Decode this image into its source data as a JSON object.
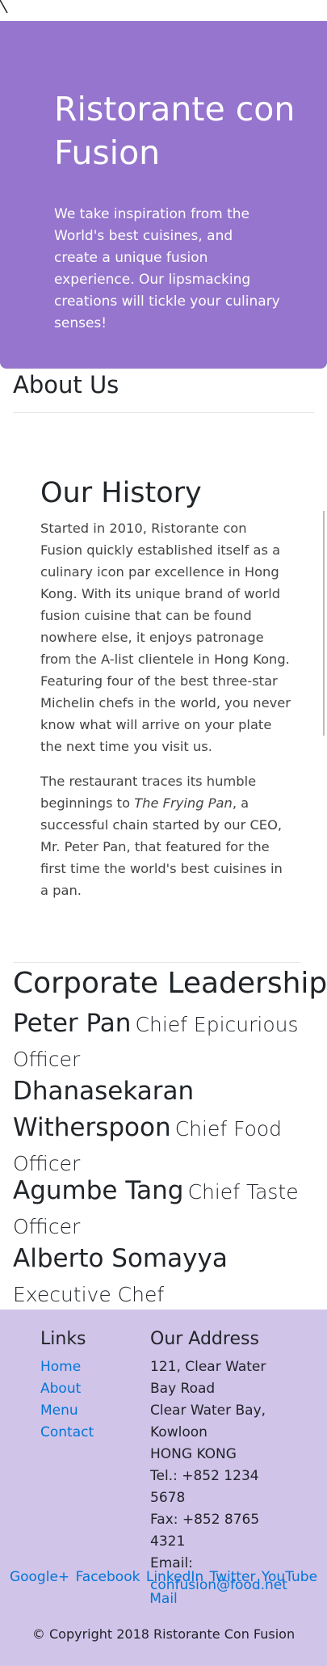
{
  "jumbotron": {
    "title": "Ristorante con Fusion",
    "tagline": "We take inspiration from the World's best cuisines, and create a unique fusion experience. Our lipsmacking creations will tickle your culinary senses!"
  },
  "about": {
    "heading": "About Us"
  },
  "history": {
    "heading": "Our History",
    "paragraph1": "Started in 2010, Ristorante con Fusion quickly established itself as a culinary icon par excellence in Hong Kong. With its unique brand of world fusion cuisine that can be found nowhere else, it enjoys patronage from the A-list clientele in Hong Kong. Featuring four of the best three-star Michelin chefs in the world, you never know what will arrive on your plate the next time you visit us.",
    "paragraph2_before": "The restaurant traces its humble beginnings to ",
    "paragraph2_em": "The Frying Pan",
    "paragraph2_after": ", a successful chain started by our CEO, Mr. Peter Pan, that featured for the first time the world's best cuisines in a pan."
  },
  "leadership": {
    "heading": "Corporate Leadership",
    "leaders": [
      {
        "name": "Peter Pan",
        "title": "Chief Epicurious Officer"
      },
      {
        "name": "Dhanasekaran Witherspoon",
        "title": "Chief Food Officer"
      },
      {
        "name": "Agumbe Tang",
        "title": "Chief Taste Officer"
      },
      {
        "name": "Alberto Somayya",
        "title": "Executive Chef"
      }
    ]
  },
  "footer": {
    "links_heading": "Links",
    "links": [
      "Home",
      "About",
      "Menu",
      "Contact"
    ],
    "address_heading": "Our Address",
    "address_line1": "121, Clear Water Bay Road",
    "address_line2": "Clear Water Bay, Kowloon",
    "address_line3": "HONG KONG",
    "tel": "Tel.: +852 1234 5678",
    "fax": "Fax: +852 8765 4321",
    "email_label": "Email:",
    "email": "confusion@food.net",
    "social": [
      "Google+",
      "Facebook",
      "LinkedIn",
      "Twitter",
      "YouTube",
      "Mail"
    ],
    "copyright": "© Copyright 2018 Ristorante Con Fusion"
  },
  "icons": {
    "nav_toggle": "navbar-toggler-icon"
  },
  "colors": {
    "jumbotron": "#9575cd",
    "footer": "#d1c4e9",
    "link": "#0275d8"
  }
}
